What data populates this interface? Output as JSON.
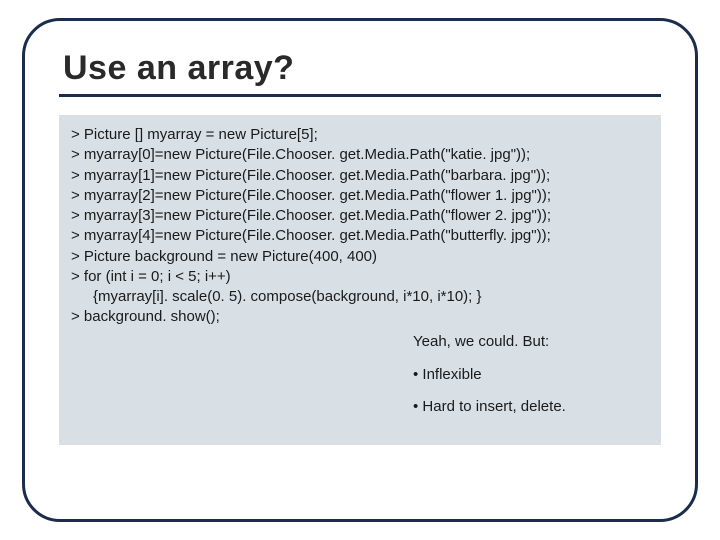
{
  "title": "Use an array?",
  "code": {
    "l1": "> Picture [] myarray = new Picture[5];",
    "l2": "> myarray[0]=new Picture(File.Chooser. get.Media.Path(\"katie. jpg\"));",
    "l3": "> myarray[1]=new Picture(File.Chooser. get.Media.Path(\"barbara. jpg\"));",
    "l4": "> myarray[2]=new Picture(File.Chooser. get.Media.Path(\"flower 1. jpg\"));",
    "l5": "> myarray[3]=new Picture(File.Chooser. get.Media.Path(\"flower 2. jpg\"));",
    "l6": "> myarray[4]=new Picture(File.Chooser. get.Media.Path(\"butterfly. jpg\"));",
    "l7": "> Picture background = new Picture(400, 400)",
    "l8": "> for (int i = 0; i < 5; i++)",
    "l9": "{myarray[i]. scale(0. 5). compose(background, i*10, i*10); }",
    "l10": "> background. show();"
  },
  "notes": {
    "lead": "Yeah, we could. But:",
    "b1": "• Inflexible",
    "b2": "• Hard to insert, delete."
  }
}
